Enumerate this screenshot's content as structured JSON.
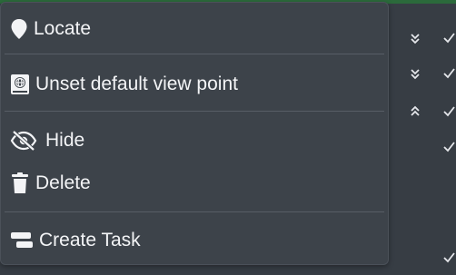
{
  "menu": {
    "items": [
      {
        "id": "locate",
        "label": "Locate",
        "icon": "location-pin-icon"
      },
      {
        "id": "unset-default",
        "label": "Unset default view point",
        "icon": "globe-book-icon"
      },
      {
        "id": "hide",
        "label": "Hide",
        "icon": "eye-slash-icon"
      },
      {
        "id": "delete",
        "label": "Delete",
        "icon": "trash-icon"
      },
      {
        "id": "create-task",
        "label": "Create Task",
        "icon": "task-card-icon"
      }
    ]
  },
  "background": {
    "row_controls": [
      {
        "arrow": "double-chevron-down-icon",
        "check": "check-icon"
      },
      {
        "arrow": "double-chevron-down-icon",
        "check": "check-icon"
      },
      {
        "arrow": "double-chevron-up-icon",
        "check": "check-icon"
      },
      {
        "arrow": "",
        "check": "check-icon"
      },
      {
        "arrow": "",
        "check": "check-icon"
      }
    ]
  },
  "colors": {
    "menu_bg": "#3d434a",
    "page_bg": "#373d44",
    "text": "#f3f4f6",
    "separator": "#585e66",
    "accent_strip": "#2b6a3b"
  }
}
